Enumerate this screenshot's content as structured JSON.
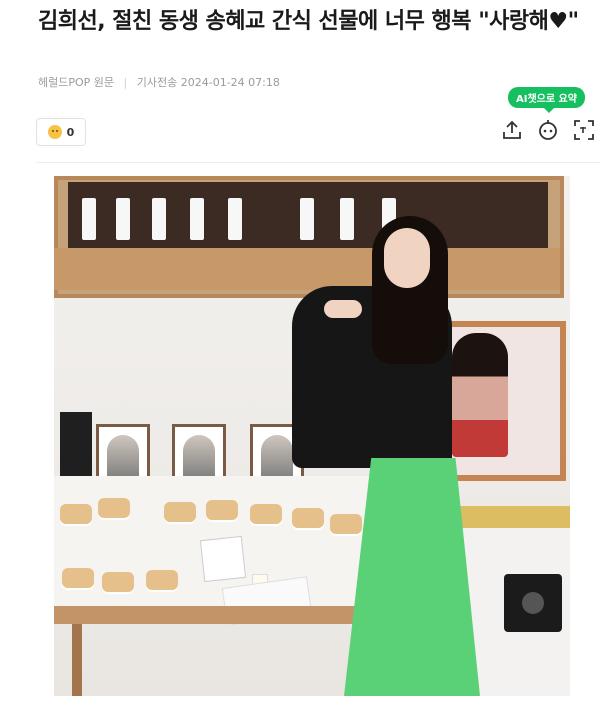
{
  "article": {
    "headline": "김희선, 절친 동생 송혜교 간식 선물에 너무 행복 \"사랑해♥\"",
    "source": "헤럴드POP 원문",
    "separator": "|",
    "sent_label": "기사전송",
    "timestamp": "2024-01-24 07:18"
  },
  "ai_badge": {
    "label": "AI챗으로 요약"
  },
  "reaction": {
    "icon": "smile-emoji-icon",
    "count": "0"
  },
  "toolbar": {
    "share_icon": "share-icon",
    "ai_chat_icon": "robot-chat-icon",
    "translate_icon": "translate-icon"
  },
  "colors": {
    "headline": "#1a1a1a",
    "meta": "#9a9a9a",
    "ai_badge": "#16c060",
    "divider": "#ececec"
  }
}
